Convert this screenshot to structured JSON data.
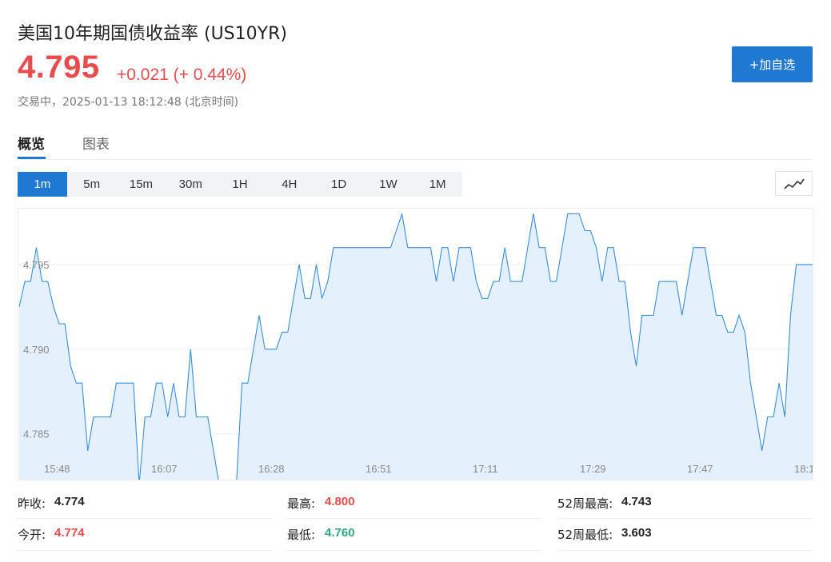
{
  "header": {
    "title": "美国10年期国债收益率  (US10YR)",
    "price": "4.795",
    "change": "+0.021 (+ 0.44%)",
    "status": "交易中，2025-01-13 18:12:48 (北京时间)",
    "add_button": "+加自选"
  },
  "tabs": [
    "概览",
    "图表"
  ],
  "periods": [
    "1m",
    "5m",
    "15m",
    "30m",
    "1H",
    "4H",
    "1D",
    "1W",
    "1M"
  ],
  "active_period": "1m",
  "chart_toggle_icon": "line-chart-icon",
  "colors": {
    "up": "#e84c4c",
    "down": "#2eaa7a",
    "accent": "#1f78d1",
    "line": "#3a8fd8",
    "fill": "#e4f0fc"
  },
  "stats": {
    "prev_close": {
      "label": "昨收:",
      "value": "4.774"
    },
    "open": {
      "label": "今开:",
      "value": "4.774"
    },
    "high": {
      "label": "最高:",
      "value": "4.800"
    },
    "low": {
      "label": "最低:",
      "value": "4.760"
    },
    "wk52_high": {
      "label": "52周最高:",
      "value": "4.743"
    },
    "wk52_low": {
      "label": "52周最低:",
      "value": "3.603"
    }
  },
  "chart_data": {
    "type": "area",
    "x_tick_labels": [
      "15:48",
      "16:07",
      "16:28",
      "16:51",
      "17:11",
      "17:29",
      "17:47",
      "18:1"
    ],
    "y_tick_labels": [
      "4.795",
      "4.790",
      "4.785"
    ],
    "y_ticks": [
      4.795,
      4.79,
      4.785
    ],
    "ylim": [
      4.7822,
      4.7983
    ],
    "grid": true,
    "values": [
      4.7925,
      4.794,
      4.794,
      4.796,
      4.794,
      4.794,
      4.7925,
      4.7915,
      4.7915,
      4.789,
      4.788,
      4.788,
      4.784,
      4.786,
      4.786,
      4.786,
      4.786,
      4.788,
      4.788,
      4.788,
      4.788,
      4.782,
      4.786,
      4.786,
      4.788,
      4.788,
      4.786,
      4.788,
      4.786,
      4.786,
      4.79,
      4.786,
      4.786,
      4.786,
      4.784,
      4.782,
      4.782,
      4.782,
      4.782,
      4.788,
      4.788,
      4.79,
      4.792,
      4.79,
      4.79,
      4.79,
      4.791,
      4.791,
      4.793,
      4.795,
      4.793,
      4.793,
      4.795,
      4.793,
      4.794,
      4.796,
      4.796,
      4.796,
      4.796,
      4.796,
      4.796,
      4.796,
      4.796,
      4.796,
      4.796,
      4.796,
      4.797,
      4.798,
      4.796,
      4.796,
      4.796,
      4.796,
      4.796,
      4.794,
      4.796,
      4.796,
      4.794,
      4.796,
      4.796,
      4.796,
      4.794,
      4.793,
      4.793,
      4.794,
      4.794,
      4.796,
      4.794,
      4.794,
      4.794,
      4.796,
      4.798,
      4.796,
      4.796,
      4.794,
      4.794,
      4.796,
      4.798,
      4.798,
      4.798,
      4.797,
      4.797,
      4.796,
      4.794,
      4.796,
      4.796,
      4.794,
      4.794,
      4.791,
      4.789,
      4.792,
      4.792,
      4.792,
      4.794,
      4.794,
      4.794,
      4.794,
      4.792,
      4.794,
      4.796,
      4.796,
      4.796,
      4.794,
      4.792,
      4.792,
      4.791,
      4.791,
      4.792,
      4.791,
      4.788,
      4.786,
      4.784,
      4.786,
      4.786,
      4.788,
      4.786,
      4.792,
      4.795,
      4.795,
      4.795,
      4.795
    ]
  },
  "icons": {
    "toggle": "line-chart-icon"
  }
}
